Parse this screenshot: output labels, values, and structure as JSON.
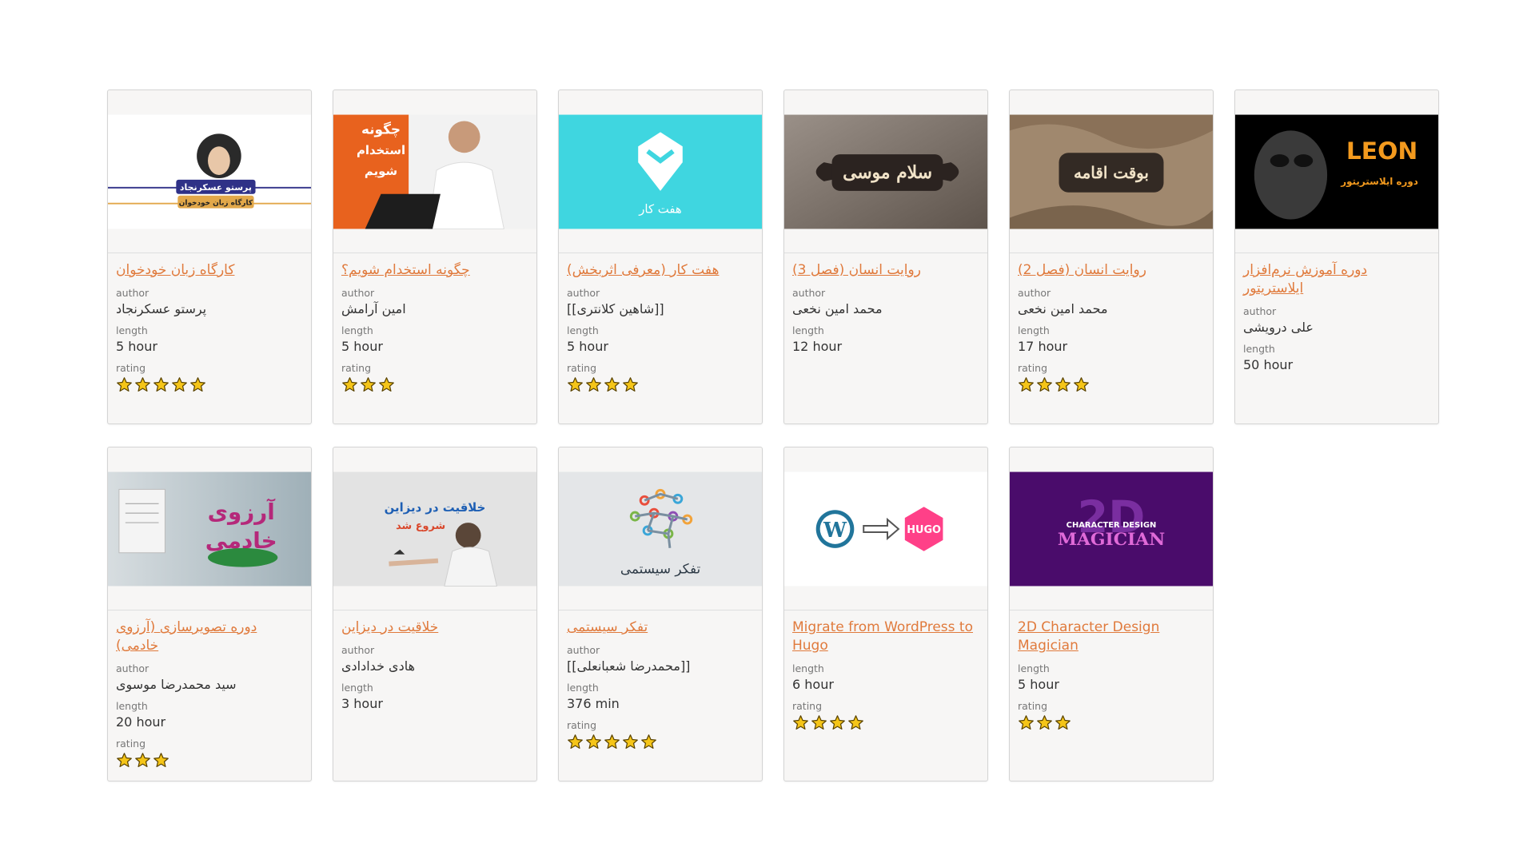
{
  "labels": {
    "author": "author",
    "length": "length",
    "rating": "rating"
  },
  "courses": [
    {
      "title": "کارگاه زبان خودخوان",
      "author": "پرستو عسکرنجاد",
      "length": "5 hour",
      "rating": 5,
      "thumb_text": [
        "پرستو عسکرنجاد",
        "کارگاه زبان خودخوان"
      ]
    },
    {
      "title": "چگونه استخدام شویم؟",
      "author": "امین آرامش",
      "length": "5 hour",
      "rating": 3,
      "thumb_text": [
        "چگونه",
        "استخدام",
        "شویم"
      ]
    },
    {
      "title": "هفت کار (معرفی اثربخش)",
      "author": "[[شاهین کلانتری]]",
      "length": "5 hour",
      "rating": 4,
      "thumb_text": [
        "هفت کار"
      ]
    },
    {
      "title": "روایت انسان (فصل 3)",
      "author": "محمد امین نخعی",
      "length": "12 hour",
      "rating": 0,
      "thumb_text": [
        "سلام موسی"
      ]
    },
    {
      "title": "روایت انسان (فصل 2)",
      "author": "محمد امین نخعی",
      "length": "17 hour",
      "rating": 4,
      "thumb_text": [
        "بوقت اقامه"
      ]
    },
    {
      "title": "دوره آموزش نرم‌افزار ایلاستریتور",
      "author": "علی درویشی",
      "length": "50 hour",
      "rating": 0,
      "thumb_text": [
        "LEON",
        "دوره ایلاستریتور"
      ]
    },
    {
      "title": "دوره تصویرسازی (آرزوی خادمی)",
      "author": "سید محمدرضا موسوی",
      "length": "20 hour",
      "rating": 3,
      "thumb_text": [
        "آرزوی",
        "خادمی"
      ]
    },
    {
      "title": "خلاقیت در دیزاین",
      "author": "هادی خدادادی",
      "length": "3 hour",
      "rating": 0,
      "thumb_text": [
        "خلاقیت در دیزاین",
        "شروع شد"
      ]
    },
    {
      "title": "تفکر سیستمی",
      "author": "[[محمدرضا شعبانعلی]]",
      "length": "376 min",
      "rating": 5,
      "thumb_text": [
        "تفکر سیستمی"
      ]
    },
    {
      "title": "Migrate from WordPress to Hugo",
      "author": null,
      "length": "6 hour",
      "rating": 4,
      "thumb_text": [
        "HUGO"
      ]
    },
    {
      "title": "2D Character Design Magician",
      "author": null,
      "length": "5 hour",
      "rating": 3,
      "thumb_text": [
        "CHARACTER DESIGN",
        "2D",
        "MAGICIAN"
      ]
    }
  ],
  "colors": {
    "link": "#e07a3c",
    "star_fill": "#f5c518",
    "star_stroke": "#5a4300"
  }
}
